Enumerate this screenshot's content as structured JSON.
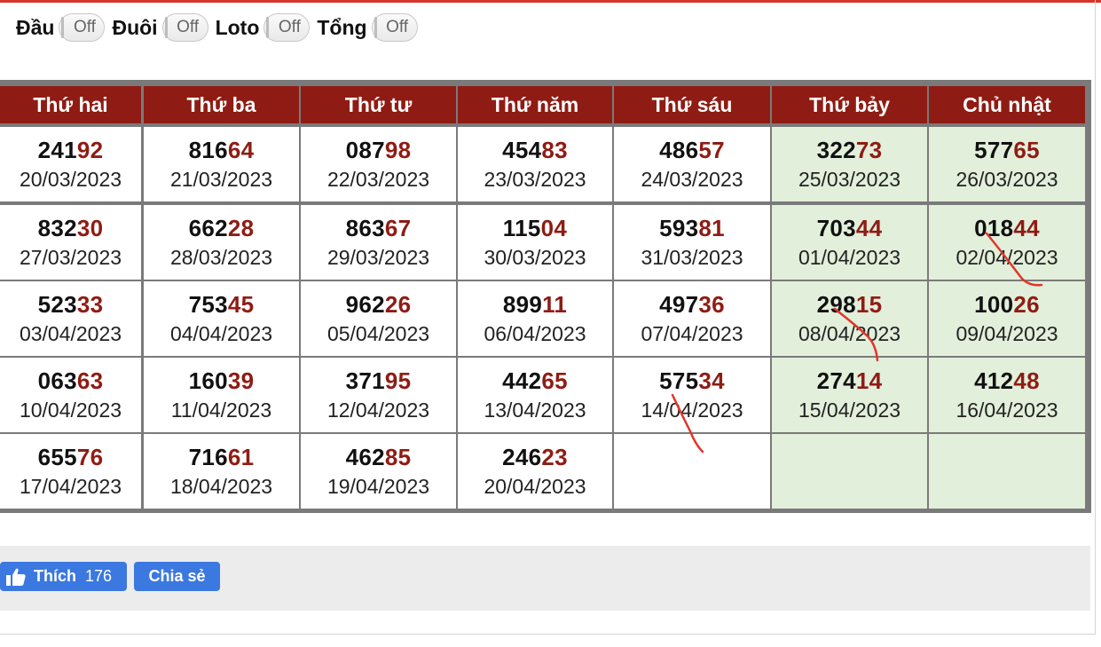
{
  "filters": [
    {
      "label": "Đầu",
      "state": "Off"
    },
    {
      "label": "Đuôi",
      "state": "Off"
    },
    {
      "label": "Loto",
      "state": "Off"
    },
    {
      "label": "Tổng",
      "state": "Off"
    }
  ],
  "weekdays": [
    "Thứ hai",
    "Thứ ba",
    "Thứ tư",
    "Thứ năm",
    "Thứ sáu",
    "Thứ bảy",
    "Chủ nhật"
  ],
  "rows": [
    [
      {
        "head": "241",
        "tail": "92",
        "date": "20/03/2023"
      },
      {
        "head": "816",
        "tail": "64",
        "date": "21/03/2023"
      },
      {
        "head": "087",
        "tail": "98",
        "date": "22/03/2023"
      },
      {
        "head": "454",
        "tail": "83",
        "date": "23/03/2023"
      },
      {
        "head": "486",
        "tail": "57",
        "date": "24/03/2023"
      },
      {
        "head": "322",
        "tail": "73",
        "date": "25/03/2023"
      },
      {
        "head": "577",
        "tail": "65",
        "date": "26/03/2023"
      }
    ],
    [
      {
        "head": "832",
        "tail": "30",
        "date": "27/03/2023"
      },
      {
        "head": "662",
        "tail": "28",
        "date": "28/03/2023"
      },
      {
        "head": "863",
        "tail": "67",
        "date": "29/03/2023"
      },
      {
        "head": "115",
        "tail": "04",
        "date": "30/03/2023"
      },
      {
        "head": "593",
        "tail": "81",
        "date": "31/03/2023"
      },
      {
        "head": "703",
        "tail": "44",
        "date": "01/04/2023"
      },
      {
        "head": "018",
        "tail": "44",
        "date": "02/04/2023"
      }
    ],
    [
      {
        "head": "523",
        "tail": "33",
        "date": "03/04/2023"
      },
      {
        "head": "753",
        "tail": "45",
        "date": "04/04/2023"
      },
      {
        "head": "962",
        "tail": "26",
        "date": "05/04/2023"
      },
      {
        "head": "899",
        "tail": "11",
        "date": "06/04/2023"
      },
      {
        "head": "497",
        "tail": "36",
        "date": "07/04/2023"
      },
      {
        "head": "298",
        "tail": "15",
        "date": "08/04/2023"
      },
      {
        "head": "100",
        "tail": "26",
        "date": "09/04/2023"
      }
    ],
    [
      {
        "head": "063",
        "tail": "63",
        "date": "10/04/2023"
      },
      {
        "head": "160",
        "tail": "39",
        "date": "11/04/2023"
      },
      {
        "head": "371",
        "tail": "95",
        "date": "12/04/2023"
      },
      {
        "head": "442",
        "tail": "65",
        "date": "13/04/2023"
      },
      {
        "head": "575",
        "tail": "34",
        "date": "14/04/2023"
      },
      {
        "head": "274",
        "tail": "14",
        "date": "15/04/2023"
      },
      {
        "head": "412",
        "tail": "48",
        "date": "16/04/2023"
      }
    ],
    [
      {
        "head": "655",
        "tail": "76",
        "date": "17/04/2023"
      },
      {
        "head": "716",
        "tail": "61",
        "date": "18/04/2023"
      },
      {
        "head": "462",
        "tail": "85",
        "date": "19/04/2023"
      },
      {
        "head": "246",
        "tail": "23",
        "date": "20/04/2023"
      },
      null,
      null,
      null
    ]
  ],
  "social": {
    "like_label": "Thích",
    "like_count": "176",
    "share_label": "Chia sẻ"
  },
  "colors": {
    "header_bg": "#8f1c14",
    "tail_digits": "#8f1c14",
    "weekend_bg": "#e2efdb",
    "grid": "#7a7a7a",
    "button_blue": "#3b78e0",
    "handwriting": "#e0362b"
  },
  "icons": {
    "like_button": "thumbs-up-icon"
  }
}
